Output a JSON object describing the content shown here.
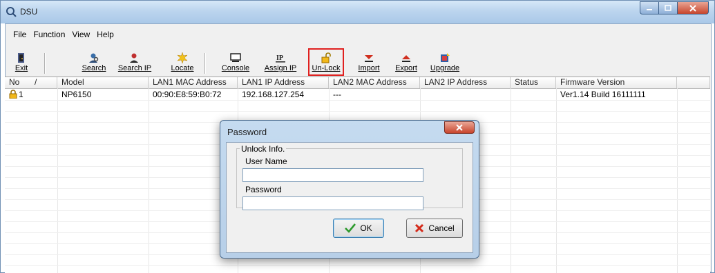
{
  "window": {
    "title": "DSU"
  },
  "menu": [
    {
      "label": "File"
    },
    {
      "label": "Function"
    },
    {
      "label": "View"
    },
    {
      "label": "Help"
    }
  ],
  "toolbar": {
    "exit": "Exit",
    "search": "Search",
    "search_ip": "Search IP",
    "locate": "Locate",
    "console": "Console",
    "assign_ip": "Assign IP",
    "unlock": "Un-Lock",
    "import": "Import",
    "export": "Export",
    "upgrade": "Upgrade"
  },
  "table": {
    "columns": [
      "No",
      "Model",
      "LAN1 MAC Address",
      "LAN1 IP Address",
      "LAN2 MAC Address",
      "LAN2 IP Address",
      "Status",
      "Firmware Version"
    ],
    "sort_indicator": "/",
    "rows": [
      {
        "no": "1",
        "model": "NP6150",
        "lan1_mac": "00:90:E8:59:B0:72",
        "lan1_ip": "192.168.127.254",
        "lan2_mac": "---",
        "lan2_ip": "",
        "status": "",
        "firmware": "Ver1.14 Build 16111111"
      }
    ]
  },
  "dialog": {
    "title": "Password",
    "group_label": "Unlock Info.",
    "user_name_label": "User Name",
    "user_name_value": "",
    "password_label": "Password",
    "password_value": "",
    "ok_label": "OK",
    "cancel_label": "Cancel"
  },
  "colors": {
    "highlight": "#e0201f",
    "titlebar": "#bcd5ee"
  }
}
